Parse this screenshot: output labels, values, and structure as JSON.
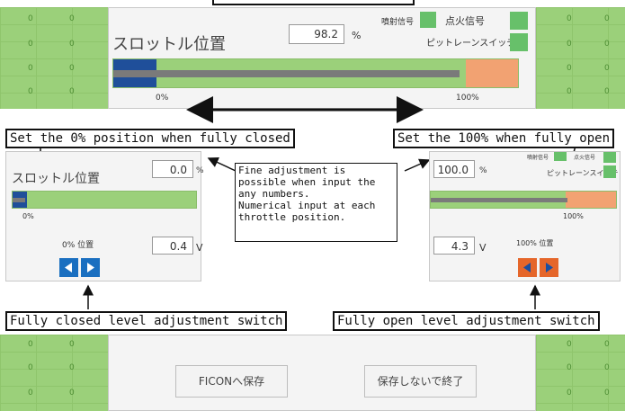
{
  "top_label": "[ image cut off at top ]",
  "grid_value": "0",
  "main_panel": {
    "title": "スロットル位置",
    "value": "98.2",
    "unit": "%",
    "injection_signal": "噴射信号",
    "ignition_signal": "点火信号",
    "pit_lane_switch": "ピットレーンスイッチ",
    "scale_min": "0%",
    "scale_max": "100%",
    "throttle_percent": 98.2
  },
  "callouts": {
    "set_zero": "Set the 0% position when fully closed",
    "set_hundred": "Set the 100% when fully open",
    "closed_switch": "Fully closed level adjustment switch",
    "open_switch": "Fully open level adjustment switch",
    "note_lines": [
      "Fine adjustment is",
      "possible when input the",
      "any numbers.",
      "Numerical input at each",
      "throttle position."
    ]
  },
  "left_panel": {
    "title": "スロットル位置",
    "value": "0.0",
    "unit": "%",
    "scale_min": "0%",
    "position_label": "0% 位置",
    "voltage": "0.4",
    "voltage_unit": "V"
  },
  "right_panel": {
    "value": "100.0",
    "unit": "%",
    "injection_signal": "噴射信号",
    "ignition_signal": "点火信号",
    "pit_lane_switch": "ピットレーンスイッチ",
    "scale_max": "100%",
    "position_label": "100% 位置",
    "voltage": "4.3",
    "voltage_unit": "V"
  },
  "bottom": {
    "save_button": "FICONへ保存",
    "exit_button": "保存しないで終了"
  },
  "colors": {
    "blue": "#1f4f9a",
    "green": "#9bd07a",
    "salmon": "#f2a272",
    "arrow_blue": "#1a6fc0",
    "arrow_orange": "#e5662a"
  }
}
